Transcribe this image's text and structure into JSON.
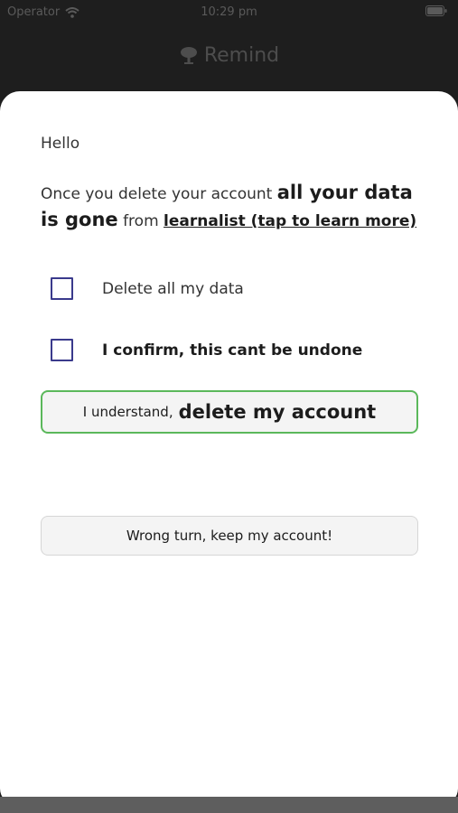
{
  "status_bar": {
    "carrier": "Operator",
    "time": "10:29 pm",
    "icons": [
      "wifi-icon",
      "battery-icon"
    ]
  },
  "app_header": {
    "title": "Remind",
    "icon": "tree-icon"
  },
  "sheet": {
    "greeting": "Hello",
    "warning": {
      "part1": "Once you delete your account ",
      "strong": "all your data is gone",
      "part2": " from ",
      "link": "learnalist (tap to learn more)"
    },
    "checkboxes": [
      {
        "label": "Delete all my data",
        "checked": false
      },
      {
        "label": "I confirm, this cant be undone",
        "checked": false
      }
    ],
    "delete_button": {
      "small": "I understand,",
      "big": "delete my account"
    },
    "keep_button": {
      "label": "Wrong turn, keep my account!"
    }
  },
  "colors": {
    "accent_border": "#5bb85b",
    "checkbox_border": "#3a3a8c",
    "backdrop": "#1e1e1e"
  }
}
